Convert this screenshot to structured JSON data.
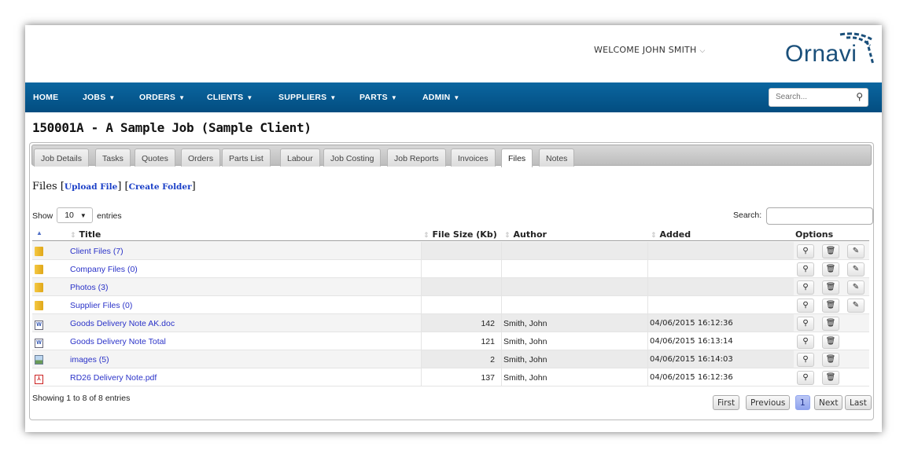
{
  "header": {
    "welcome": "WELCOME JOHN SMITH",
    "welcome_caret": "⌵",
    "logo": "Ornavi"
  },
  "nav": {
    "items": [
      {
        "label": "HOME"
      },
      {
        "label": "JOBS"
      },
      {
        "label": "ORDERS"
      },
      {
        "label": "CLIENTS"
      },
      {
        "label": "SUPPLIERS"
      },
      {
        "label": "PARTS"
      },
      {
        "label": "ADMIN"
      }
    ],
    "caret": "▼",
    "search_placeholder": "Search...",
    "search_icon": "⚲"
  },
  "page_title": "150001A - A Sample Job (Sample Client)",
  "tabs": [
    {
      "label": "Job Details"
    },
    {
      "label": "Tasks"
    },
    {
      "label": "Quotes"
    },
    {
      "label": "Orders"
    },
    {
      "label": "Parts List"
    },
    {
      "label": "Labour"
    },
    {
      "label": "Job Costing"
    },
    {
      "label": "Job Reports"
    },
    {
      "label": "Invoices"
    },
    {
      "label": "Files",
      "active": true
    },
    {
      "label": "Notes"
    }
  ],
  "files_section": {
    "heading": "Files",
    "upload_link": "Upload File",
    "create_folder_link": "Create Folder",
    "bracket_open": "[",
    "bracket_close": "]"
  },
  "table_controls": {
    "show_label": "Show",
    "page_size": "10",
    "entries_label": "entries",
    "search_label": "Search:"
  },
  "table": {
    "columns": [
      "Title",
      "File Size (Kb)",
      "Author",
      "Added",
      "Options"
    ],
    "rows": [
      {
        "type": "folder",
        "icon": "folder-icon",
        "title": "Client Files (7)",
        "size": "",
        "author": "",
        "added": "",
        "edit": true
      },
      {
        "type": "folder",
        "icon": "folder-icon",
        "title": "Company Files (0)",
        "size": "",
        "author": "",
        "added": "",
        "edit": true
      },
      {
        "type": "folder",
        "icon": "folder-icon",
        "title": "Photos (3)",
        "size": "",
        "author": "",
        "added": "",
        "edit": true
      },
      {
        "type": "folder",
        "icon": "folder-icon",
        "title": "Supplier Files (0)",
        "size": "",
        "author": "",
        "added": "",
        "edit": true
      },
      {
        "type": "doc",
        "icon": "word-document-icon",
        "title": "Goods Delivery Note AK.doc",
        "size": "142",
        "author": "Smith, John",
        "added": "04/06/2015 16:12:36",
        "edit": false
      },
      {
        "type": "doc",
        "icon": "word-document-icon",
        "title": "Goods Delivery Note Total",
        "size": "121",
        "author": "Smith, John",
        "added": "04/06/2015 16:13:14",
        "edit": false
      },
      {
        "type": "img",
        "icon": "image-file-icon",
        "title": "images (5)",
        "size": "2",
        "author": "Smith, John",
        "added": "04/06/2015 16:14:03",
        "edit": false
      },
      {
        "type": "pdf",
        "icon": "pdf-file-icon",
        "title": "RD26 Delivery Note.pdf",
        "size": "137",
        "author": "Smith, John",
        "added": "04/06/2015 16:12:36",
        "edit": false
      }
    ]
  },
  "footer": {
    "info": "Showing 1 to 8 of 8 entries",
    "pagination": [
      "First",
      "Previous",
      "1",
      "Next",
      "Last"
    ]
  },
  "colors": {
    "nav_bg": "#0a66a0",
    "link": "#2a32c8",
    "logo": "#1a4f7a"
  }
}
